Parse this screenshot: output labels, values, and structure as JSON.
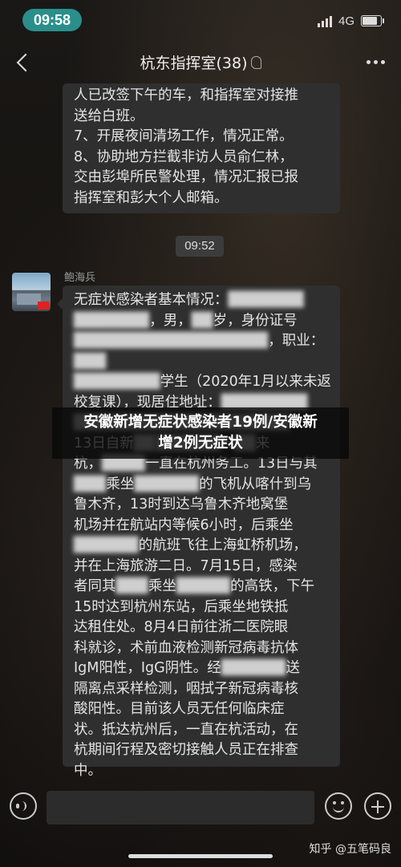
{
  "status_bar": {
    "time": "09:58",
    "network": "4G",
    "signal_bars": 4,
    "battery_level": 0.9
  },
  "nav": {
    "title": "杭东指挥室(38)"
  },
  "messages": {
    "bubble1_lines": [
      "人已改签下午的车，和指挥室对接推",
      "送给白班。",
      "7、开展夜间清场工作，情况正常。",
      "8、协助地方拦截非访人员俞仁林，",
      "交由彭埠所民警处理，情况汇报已报",
      "指挥室和彭大个人邮箱。"
    ],
    "timestamp": "09:52",
    "sender": "鲍海兵",
    "bubble2_lines": [
      {
        "parts": [
          {
            "t": "无症状感染者基本情况：",
            "b": false
          },
          {
            "t": "███████",
            "b": true
          }
        ]
      },
      {
        "parts": [
          {
            "t": "███████",
            "b": true
          },
          {
            "t": "，男，",
            "b": false
          },
          {
            "t": "██",
            "b": true
          },
          {
            "t": "岁，身份证号",
            "b": false
          }
        ]
      },
      {
        "parts": [
          {
            "t": "██████████████████",
            "b": true
          },
          {
            "t": "，职业：",
            "b": false
          },
          {
            "t": "███",
            "b": true
          }
        ]
      },
      {
        "parts": [
          {
            "t": "████████",
            "b": true
          },
          {
            "t": "学生（2020年1月以来未返",
            "b": false
          }
        ]
      },
      {
        "parts": [
          {
            "t": "校复课），现居住地址：",
            "b": false
          },
          {
            "t": "████████",
            "b": true
          }
        ]
      },
      {
        "parts": [
          {
            "t": "████████████████████",
            "b": true
          }
        ]
      },
      {
        "parts": [
          {
            "t": "13日自新",
            "b": false
          },
          {
            "t": "██",
            "b": true
          },
          {
            "t": "██████",
            "b": true
          },
          {
            "t": "县",
            "b": false
          },
          {
            "t": "██",
            "b": true
          },
          {
            "t": "来",
            "b": false
          }
        ]
      },
      {
        "parts": [
          {
            "t": "杭，",
            "b": false
          },
          {
            "t": "████",
            "b": true
          },
          {
            "t": "一直在杭州务工。13日与其",
            "b": false
          }
        ]
      },
      {
        "parts": [
          {
            "t": "███",
            "b": true
          },
          {
            "t": "乘坐",
            "b": false
          },
          {
            "t": "██████",
            "b": true
          },
          {
            "t": "的飞机从喀什到乌",
            "b": false
          }
        ]
      },
      {
        "parts": [
          {
            "t": "鲁木齐，13时到达乌鲁木齐地窝堡",
            "b": false
          }
        ]
      },
      {
        "parts": [
          {
            "t": "机场并在航站内等候6小时，后乘坐",
            "b": false
          }
        ]
      },
      {
        "parts": [
          {
            "t": "██████",
            "b": true
          },
          {
            "t": "的航班飞往上海虹桥机场，",
            "b": false
          }
        ]
      },
      {
        "parts": [
          {
            "t": "并在上海旅游二日。7月15日，感染",
            "b": false
          }
        ]
      },
      {
        "parts": [
          {
            "t": "者同其",
            "b": false
          },
          {
            "t": "███",
            "b": true
          },
          {
            "t": "乘坐",
            "b": false
          },
          {
            "t": "█████",
            "b": true
          },
          {
            "t": "的高铁，下午",
            "b": false
          }
        ]
      },
      {
        "parts": [
          {
            "t": "15时达到杭州东站，后乘坐地铁抵",
            "b": false
          }
        ]
      },
      {
        "parts": [
          {
            "t": "达租住处。8月4日前往浙二医院眼",
            "b": false
          }
        ]
      },
      {
        "parts": [
          {
            "t": "科就诊，术前血液检测新冠病毒抗体",
            "b": false
          }
        ]
      },
      {
        "parts": [
          {
            "t": "IgM阳性，IgG阴性。经",
            "b": false
          },
          {
            "t": "██████",
            "b": true
          },
          {
            "t": "送",
            "b": false
          }
        ]
      },
      {
        "parts": [
          {
            "t": "隔离点采样检测，咽拭子新冠病毒核",
            "b": false
          }
        ]
      },
      {
        "parts": [
          {
            "t": "酸阳性。目前该人员无任何临床症",
            "b": false
          }
        ]
      },
      {
        "parts": [
          {
            "t": "状。抵达杭州后，一直在杭活动，在",
            "b": false
          }
        ]
      },
      {
        "parts": [
          {
            "t": "杭期间行程及密切接触人员正在排查",
            "b": false
          }
        ]
      },
      {
        "parts": [
          {
            "t": "中。",
            "b": false
          }
        ]
      }
    ]
  },
  "overlay": {
    "line1": "安徽新增无症状感染者19例/安徽新",
    "line2": "增2例无症状"
  },
  "watermark": "知乎 @五笔码良",
  "colors": {
    "time_pill": "#2a8f8a",
    "bubble": "#2f2f2f",
    "background": "#15120f"
  }
}
